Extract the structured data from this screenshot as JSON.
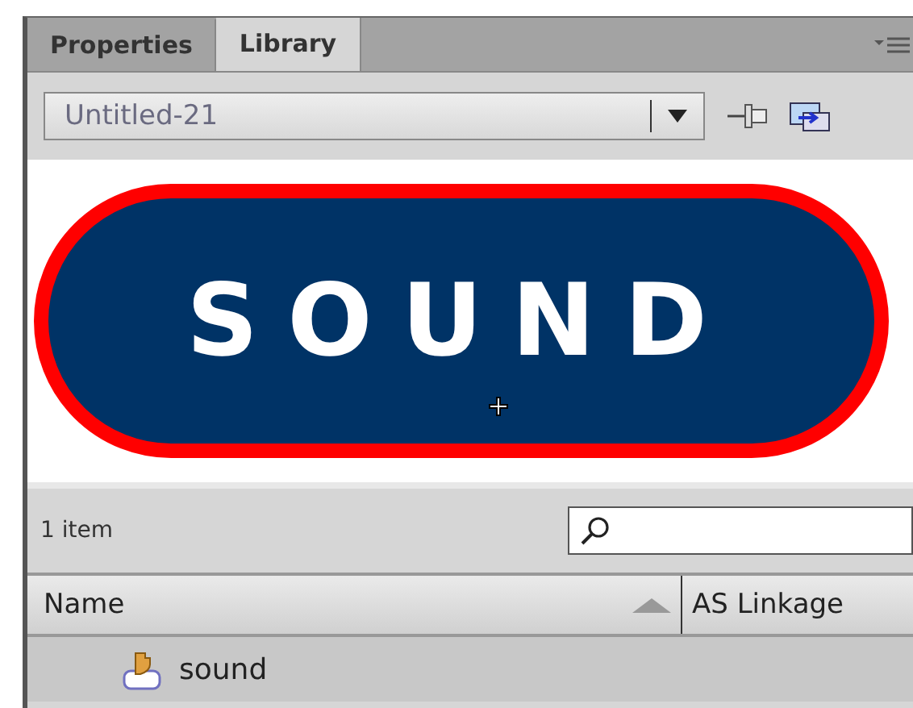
{
  "tabs": [
    {
      "label": "Properties",
      "selected": false
    },
    {
      "label": "Library",
      "selected": true
    }
  ],
  "library_select": {
    "value": "Untitled-21"
  },
  "preview": {
    "label": "SOUND"
  },
  "status": {
    "count": "1 item"
  },
  "columns": [
    {
      "label": "Name",
      "sorted": true
    },
    {
      "label": "AS Linkage",
      "sorted": false
    }
  ],
  "items": [
    {
      "name": "sound",
      "selected": true
    }
  ]
}
